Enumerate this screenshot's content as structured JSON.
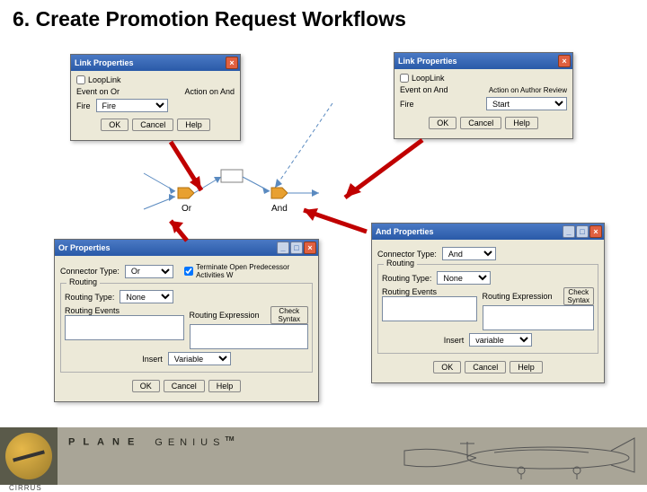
{
  "slide": {
    "title": "6. Create Promotion Request Workflows"
  },
  "branding": {
    "name_strong": "PLANE",
    "name_light": "GENIUS",
    "tm": "TM",
    "cirrus": "CIRRUS"
  },
  "link_left": {
    "title": "Link Properties",
    "loopLink": "LoopLink",
    "eventOnLabel": "Event on Or",
    "actionLabel": "Action on And",
    "fireLabel": "Fire",
    "fireValue": "Fire",
    "ok": "OK",
    "cancel": "Cancel",
    "help": "Help"
  },
  "link_right": {
    "title": "Link Properties",
    "loopLink": "LoopLink",
    "eventLabel": "Event on And",
    "actionLabel": "Action on Author Review",
    "fireLabel": "Fire",
    "fireValue": "Start",
    "ok": "OK",
    "cancel": "Cancel",
    "help": "Help"
  },
  "or_props": {
    "title": "Or Properties",
    "connectorTypeLabel": "Connector Type:",
    "connectorTypeValue": "Or",
    "terminateLabel": "Terminate Open Predecessor Activities W",
    "routingLegend": "Routing",
    "routingTypeLabel": "Routing Type:",
    "routingTypeValue": "None",
    "routingEventsLabel": "Routing Events",
    "routingExpressionLabel": "Routing Expression",
    "checkSyntax": "Check Syntax",
    "insertLabel": "Insert",
    "insertValue": "Variable",
    "ok": "OK",
    "cancel": "Cancel",
    "help": "Help"
  },
  "and_props": {
    "title": "And Properties",
    "connectorTypeLabel": "Connector Type:",
    "connectorTypeValue": "And",
    "routingLegend": "Routing",
    "routingTypeLabel": "Routing Type:",
    "routingTypeValue": "None",
    "routingEventsLabel": "Routing Events",
    "routingExpressionLabel": "Routing Expression",
    "checkSyntax": "Check Syntax",
    "insertLabel": "Insert",
    "insertValue": "variable",
    "ok": "OK",
    "cancel": "Cancel",
    "help": "Help"
  },
  "workflow": {
    "or_label": "Or",
    "and_label": "And"
  }
}
